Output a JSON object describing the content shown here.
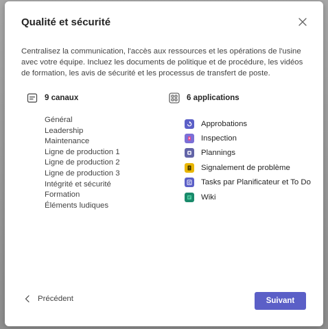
{
  "dialog": {
    "title": "Qualité et sécurité",
    "description": "Centralisez la communication, l'accès aux ressources et les opérations de l'usine avec votre équipe. Incluez les documents de politique et de procédure, les vidéos de formation, les avis de sécurité et les processus de transfert de poste."
  },
  "channels": {
    "header": "9 canaux",
    "icon": "channel-icon",
    "items": [
      "Général",
      "Leadership",
      "Maintenance",
      "Ligne de production 1",
      "Ligne de production 2",
      "Ligne de production 3",
      "Intégrité et sécurité",
      "Formation",
      "Éléments ludiques"
    ]
  },
  "apps": {
    "header": "6 applications",
    "icon": "apps-grid-icon",
    "items": [
      {
        "label": "Approbations",
        "icon": "approvals-icon",
        "color": "#5b5fc7"
      },
      {
        "label": "Inspection",
        "icon": "inspection-icon",
        "color": "#7b6fd6"
      },
      {
        "label": "Plannings",
        "icon": "shifts-icon",
        "color": "#6264a7"
      },
      {
        "label": "Signalement de problème",
        "icon": "issue-reporting-icon",
        "color": "#e8b500"
      },
      {
        "label": "Tasks par Planificateur et To Do",
        "icon": "tasks-icon",
        "color": "#5b5fc7"
      },
      {
        "label": "Wiki",
        "icon": "wiki-icon",
        "color": "#1a8a6b"
      }
    ]
  },
  "footer": {
    "back_label": "Précédent",
    "next_label": "Suivant",
    "accent_color": "#5b5fc7"
  }
}
